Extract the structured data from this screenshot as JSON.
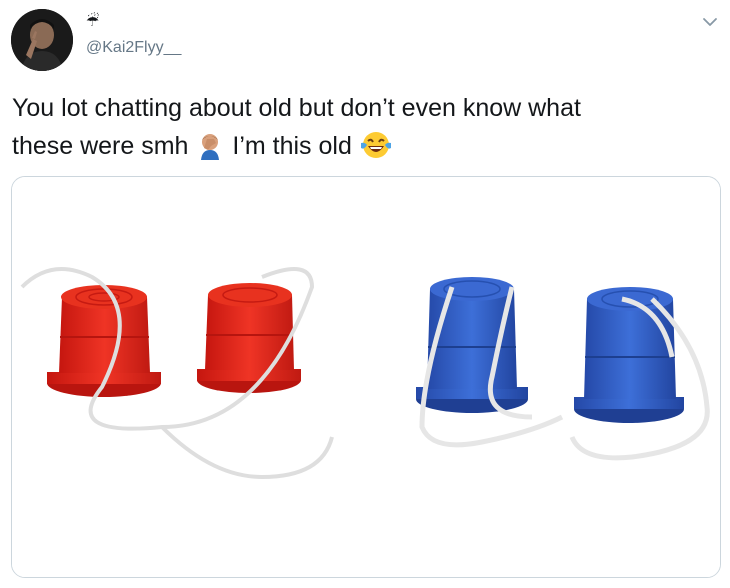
{
  "tweet": {
    "display_name": "☔",
    "handle": "@Kai2Flyy__",
    "text_line1": "You lot chatting about old but don’t even know what",
    "text_line2a": "these were smh",
    "text_line2b": "I’m this old",
    "emoji_1": "man-facepalming-icon",
    "emoji_2": "face-with-tears-of-joy-icon"
  },
  "media": {
    "subject": "tin-can-stilts",
    "colors": {
      "red": "#e2231a",
      "blue": "#2e5fc9",
      "rope": "#ffffff"
    }
  },
  "colors": {
    "text": "#14171a",
    "muted": "#657786",
    "border": "#ccd6dd"
  }
}
